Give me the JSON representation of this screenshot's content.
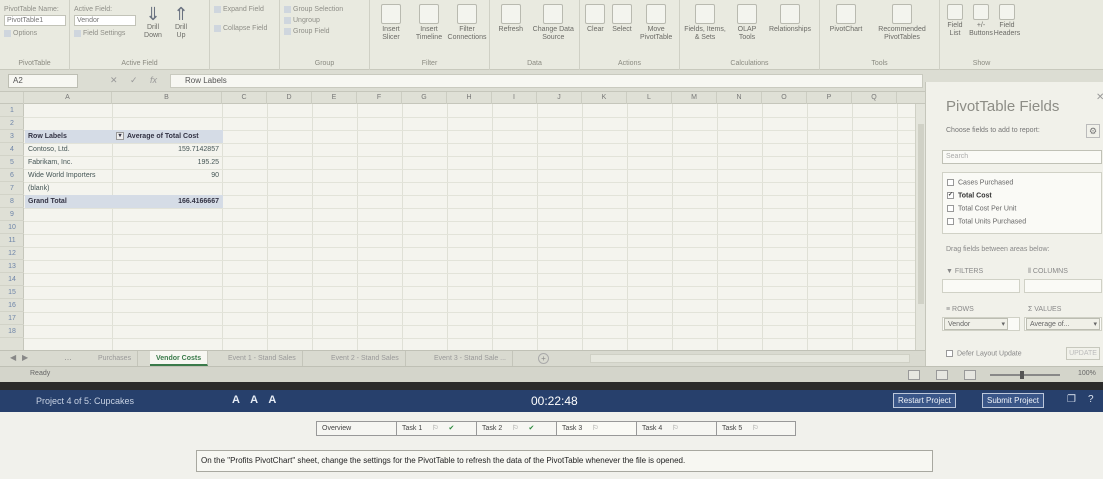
{
  "ribbon": {
    "pivottable_name_label": "PivotTable Name:",
    "pivottable_name_value": "PivotTable1",
    "options_label": "Options",
    "pivottable_group": "PivotTable",
    "active_field_label": "Active Field:",
    "active_field_value": "Vendor",
    "field_settings": "Field Settings",
    "drill_down": "Drill Down",
    "drill_up": "Drill Up",
    "expand_field": "Expand Field",
    "collapse_field": "Collapse Field",
    "active_field_group": "Active Field",
    "group_selection": "Group Selection",
    "ungroup": "Ungroup",
    "group_field": "Group Field",
    "group_group": "Group",
    "insert_slicer": "Insert Slicer",
    "insert_timeline": "Insert Timeline",
    "filter_connections": "Filter Connections",
    "filter_group": "Filter",
    "refresh": "Refresh",
    "change_data_source": "Change Data Source",
    "data_group": "Data",
    "clear": "Clear",
    "select": "Select",
    "move_pivottable": "Move PivotTable",
    "actions_group": "Actions",
    "fields_items_sets": "Fields, Items, & Sets",
    "olap_tools": "OLAP Tools",
    "relationships": "Relationships",
    "calculations_group": "Calculations",
    "pivotchart": "PivotChart",
    "recommended_pivottables": "Recommended PivotTables",
    "tools_group": "Tools",
    "field_list": "Field List",
    "buttons": "+/- Buttons",
    "field_headers": "Field Headers",
    "show_group": "Show"
  },
  "formula_bar": {
    "name_box": "A2",
    "fx": "fx",
    "content": "Row Labels"
  },
  "grid": {
    "columns": [
      "A",
      "B",
      "C",
      "D",
      "E",
      "F",
      "G",
      "H",
      "I",
      "J",
      "K",
      "L",
      "M",
      "N",
      "O",
      "P",
      "Q"
    ],
    "rows": [
      "1",
      "2",
      "3",
      "4",
      "5",
      "6",
      "7",
      "8",
      "9",
      "10",
      "11",
      "12",
      "13",
      "14",
      "15",
      "16",
      "17",
      "18"
    ],
    "pivot": {
      "header_label": "Row Labels",
      "header_value": "Average of Total Cost",
      "rows": [
        {
          "label": "Contoso, Ltd.",
          "value": "159.7142857"
        },
        {
          "label": "Fabrikam, Inc.",
          "value": "195.25"
        },
        {
          "label": "Wide World Importers",
          "value": "90"
        },
        {
          "label": "(blank)",
          "value": ""
        }
      ],
      "total_label": "Grand Total",
      "total_value": "166.4166667"
    }
  },
  "sheet_tabs": [
    {
      "label": "Purchases",
      "active": false
    },
    {
      "label": "Vendor Costs",
      "active": true
    },
    {
      "label": "Event 1 - Stand Sales",
      "active": false
    },
    {
      "label": "Event 2 - Stand Sales",
      "active": false
    },
    {
      "label": "Event 3 - Stand Sale ...",
      "active": false
    }
  ],
  "status_bar": {
    "ready": "Ready",
    "zoom": "100%"
  },
  "pivot_pane": {
    "title": "PivotTable Fields",
    "subtitle": "Choose fields to add to report:",
    "search_placeholder": "Search",
    "fields": [
      {
        "label": "Cases Purchased",
        "checked": false
      },
      {
        "label": "Total Cost",
        "checked": true
      },
      {
        "label": "Total Cost Per Unit",
        "checked": false
      },
      {
        "label": "Total Units Purchased",
        "checked": false
      }
    ],
    "drag_hint": "Drag fields between areas below:",
    "filters": "FILTERS",
    "columns": "COLUMNS",
    "rows": "ROWS",
    "values": "VALUES",
    "rows_item": "Vendor",
    "values_item": "Average of...",
    "defer_label": "Defer Layout Update",
    "update_button": "UPDATE"
  },
  "exam": {
    "project_label": "Project 4 of 5: Cupcakes",
    "font_controls": "A A A",
    "timer": "00:22:48",
    "restart_button": "Restart Project",
    "submit_button": "Submit Project"
  },
  "tasks": [
    {
      "label": "Overview",
      "flag": false,
      "done": false
    },
    {
      "label": "Task 1",
      "flag": true,
      "done": true
    },
    {
      "label": "Task 2",
      "flag": true,
      "done": true
    },
    {
      "label": "Task 3",
      "flag": true,
      "done": false
    },
    {
      "label": "Task 4",
      "flag": true,
      "done": false
    },
    {
      "label": "Task 5",
      "flag": true,
      "done": false
    }
  ],
  "task_description": "On the \"Profits PivotChart\" sheet, change the settings for the PivotTable to refresh the data of the PivotTable whenever the file is opened."
}
